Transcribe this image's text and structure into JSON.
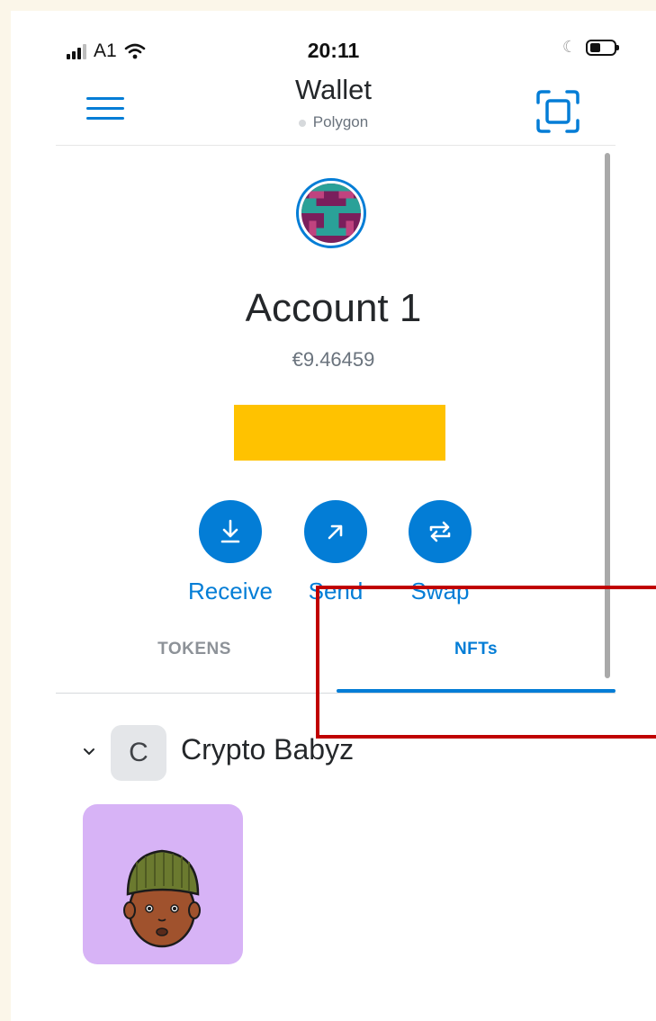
{
  "status_bar": {
    "carrier": "A1",
    "time": "20:11",
    "icons": [
      "signal-icon",
      "wifi-icon",
      "moon-icon",
      "battery-icon"
    ]
  },
  "header": {
    "title": "Wallet",
    "network": "Polygon",
    "menu_icon": "hamburger-menu-icon",
    "scan_icon": "qr-scan-icon"
  },
  "account": {
    "name": "Account 1",
    "balance": "€9.46459",
    "address_redacted": true
  },
  "actions": [
    {
      "label": "Receive",
      "icon": "arrow-down-icon"
    },
    {
      "label": "Send",
      "icon": "arrow-up-right-icon"
    },
    {
      "label": "Swap",
      "icon": "swap-arrows-icon"
    }
  ],
  "tabs": [
    {
      "label": "TOKENS",
      "active": false
    },
    {
      "label": "NFTs",
      "active": true
    }
  ],
  "collection": {
    "initial": "C",
    "name": "Crypto Babyz",
    "expand_icon": "chevron-down-icon"
  },
  "colors": {
    "accent": "#037dd6",
    "redaction": "#ffc200",
    "highlight": "#c00000",
    "nft_background": "#d7b3f6"
  }
}
